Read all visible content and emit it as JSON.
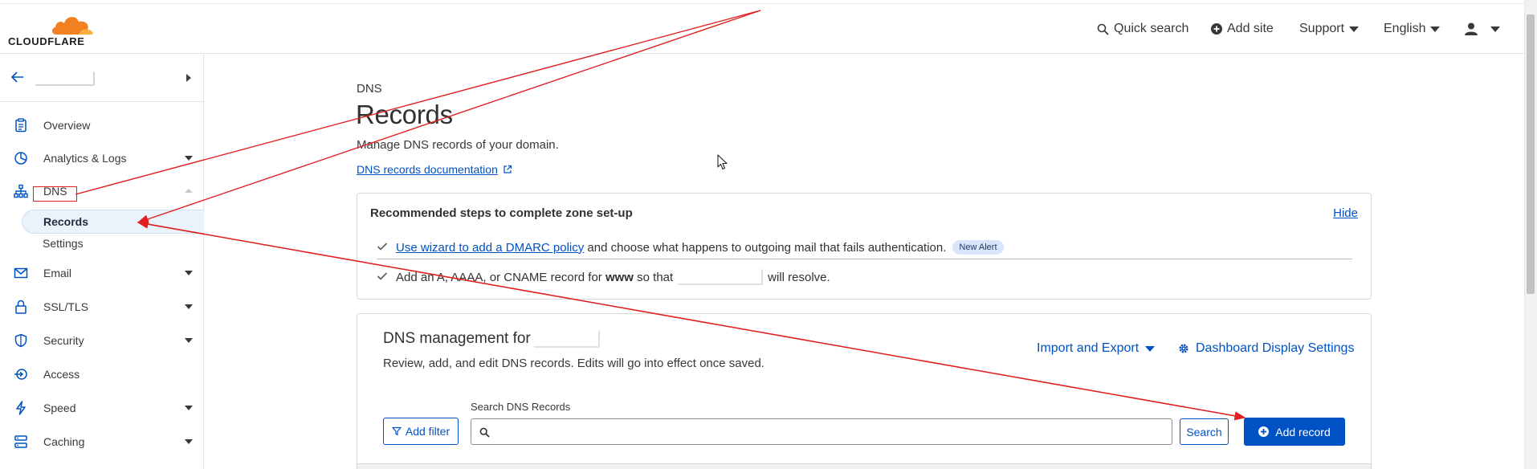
{
  "header": {
    "brand": "CLOUDFLARE",
    "quick_search": "Quick search",
    "add_site": "Add site",
    "support": "Support",
    "language": "English"
  },
  "sidebar": {
    "items": [
      {
        "label": "Overview",
        "icon": "clipboard-icon"
      },
      {
        "label": "Analytics & Logs",
        "icon": "pie-chart-icon"
      },
      {
        "label": "DNS",
        "icon": "network-icon"
      },
      {
        "label": "Email",
        "icon": "envelope-icon"
      },
      {
        "label": "SSL/TLS",
        "icon": "lock-icon"
      },
      {
        "label": "Security",
        "icon": "shield-icon"
      },
      {
        "label": "Access",
        "icon": "access-icon"
      },
      {
        "label": "Speed",
        "icon": "lightning-icon"
      },
      {
        "label": "Caching",
        "icon": "caching-icon"
      }
    ],
    "dns_sub": [
      "Records",
      "Settings"
    ]
  },
  "main": {
    "breadcrumb": "DNS",
    "title": "Records",
    "description": "Manage DNS records of your domain.",
    "doc_link": "DNS records documentation"
  },
  "recommended": {
    "title": "Recommended steps to complete zone set-up",
    "hide": "Hide",
    "step1_link": "Use wizard to add a DMARC policy",
    "step1_text": " and choose what happens to outgoing mail that fails authentication.",
    "step1_badge": "New Alert",
    "step2_pre": "Add an A, AAAA, or CNAME record for ",
    "step2_bold": "www",
    "step2_mid": " so that",
    "step2_post": "will resolve."
  },
  "management": {
    "title": "DNS management for",
    "description": "Review, add, and edit DNS records. Edits will go into effect once saved.",
    "import_export": "Import and Export",
    "display_settings": "Dashboard Display Settings",
    "search_label": "Search DNS Records",
    "add_filter": "Add filter",
    "search_button": "Search",
    "add_record": "Add record"
  },
  "colors": {
    "accent": "#0051c3",
    "brand_orange": "#f38020",
    "annotation_red": "#e02020"
  }
}
